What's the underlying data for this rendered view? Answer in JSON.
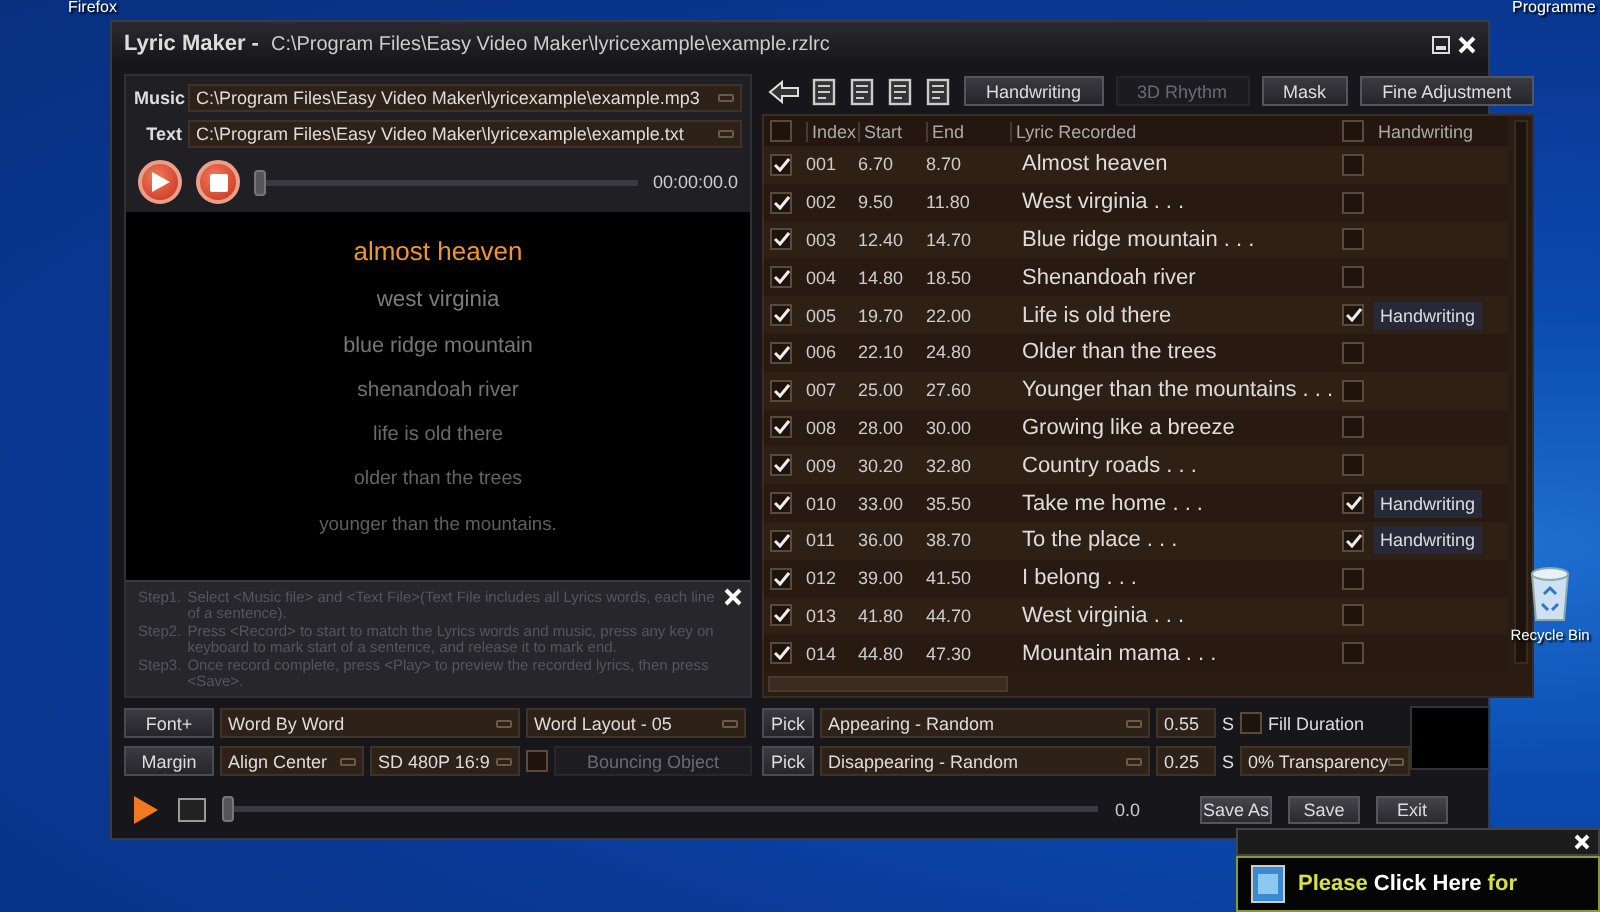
{
  "desktop": {
    "icons": [
      {
        "label": "Firefox",
        "kind": "top-left"
      },
      {
        "label": "Programme",
        "kind": "top-right"
      },
      {
        "label": "Recycle Bin",
        "kind": "bin"
      }
    ]
  },
  "window": {
    "title": "Lyric Maker -",
    "path": "C:\\Program Files\\Easy Video Maker\\lyricexample\\example.rzlrc"
  },
  "files": [
    {
      "label": "Music",
      "value": "C:\\Program Files\\Easy Video Maker\\lyricexample\\example.mp3"
    },
    {
      "label": "Text",
      "value": "C:\\Program Files\\Easy Video Maker\\lyricexample\\example.txt"
    }
  ],
  "player": {
    "time": "00:00:00.0",
    "level": 0
  },
  "preview": {
    "lines": [
      {
        "text": "almost heaven",
        "selected": true
      },
      {
        "text": "west virginia",
        "selected": false
      },
      {
        "text": "blue ridge mountain",
        "selected": false
      },
      {
        "text": "shenandoah river",
        "selected": false
      },
      {
        "text": "life is old there",
        "selected": false
      },
      {
        "text": "older than the trees",
        "selected": false
      },
      {
        "text": "younger than the mountains.",
        "selected": false
      }
    ]
  },
  "help": {
    "steps": [
      {
        "label": "Step1.",
        "text": "Select <Music file> and <Text File>(Text File includes all Lyrics words, each line of a sentence)."
      },
      {
        "label": "Step2.",
        "text": "Press <Record> to start to match the Lyrics words and music, press any key on keyboard to mark start of a sentence, and release it to mark end."
      },
      {
        "label": "Step3.",
        "text": "Once record complete, press <Play> to preview the recorded lyrics, then press <Save>."
      }
    ]
  },
  "toolbar": {
    "buttons": [
      {
        "label": "Handwriting",
        "disabled": false
      },
      {
        "label": "3D Rhythm",
        "disabled": true
      },
      {
        "label": "Mask",
        "disabled": false
      },
      {
        "label": "Fine Adjustment",
        "disabled": false
      }
    ]
  },
  "table": {
    "all_checked": false,
    "handwriting_all": false,
    "columns": [
      "Index",
      "Start",
      "End",
      "Lyric Recorded",
      "Handwriting"
    ],
    "rows": [
      {
        "checked": true,
        "index": "001",
        "start": "6.70",
        "end": "8.70",
        "lyric": "Almost heaven",
        "handwriting": false
      },
      {
        "checked": true,
        "index": "002",
        "start": "9.50",
        "end": "11.80",
        "lyric": "West virginia . . .",
        "handwriting": false
      },
      {
        "checked": true,
        "index": "003",
        "start": "12.40",
        "end": "14.70",
        "lyric": "Blue ridge mountain . . .",
        "handwriting": false
      },
      {
        "checked": true,
        "index": "004",
        "start": "14.80",
        "end": "18.50",
        "lyric": "Shenandoah river",
        "handwriting": false
      },
      {
        "checked": true,
        "index": "005",
        "start": "19.70",
        "end": "22.00",
        "lyric": "Life is old there",
        "handwriting": true,
        "handwriting_label": "Handwriting"
      },
      {
        "checked": true,
        "index": "006",
        "start": "22.10",
        "end": "24.80",
        "lyric": "Older than the trees",
        "handwriting": false
      },
      {
        "checked": true,
        "index": "007",
        "start": "25.00",
        "end": "27.60",
        "lyric": "Younger than the mountains . . .",
        "handwriting": false
      },
      {
        "checked": true,
        "index": "008",
        "start": "28.00",
        "end": "30.00",
        "lyric": "Growing like a breeze",
        "handwriting": false
      },
      {
        "checked": true,
        "index": "009",
        "start": "30.20",
        "end": "32.80",
        "lyric": "Country roads . . .",
        "handwriting": false
      },
      {
        "checked": true,
        "index": "010",
        "start": "33.00",
        "end": "35.50",
        "lyric": "Take me home . . .",
        "handwriting": true,
        "handwriting_label": "Handwriting"
      },
      {
        "checked": true,
        "index": "011",
        "start": "36.00",
        "end": "38.70",
        "lyric": "To the place . . .",
        "handwriting": true,
        "handwriting_label": "Handwriting"
      },
      {
        "checked": true,
        "index": "012",
        "start": "39.00",
        "end": "41.50",
        "lyric": "I belong . . .",
        "handwriting": false
      },
      {
        "checked": true,
        "index": "013",
        "start": "41.80",
        "end": "44.70",
        "lyric": "West virginia . . .",
        "handwriting": false
      },
      {
        "checked": true,
        "index": "014",
        "start": "44.80",
        "end": "47.30",
        "lyric": "Mountain mama . . .",
        "handwriting": false
      }
    ]
  },
  "controls": {
    "font_button": "Font+",
    "text_mode": "Word By Word",
    "word_layout": "Word Layout - 05",
    "margin_button": "Margin",
    "align": "Align Center",
    "resolution": "SD 480P 16:9",
    "bouncing": {
      "checked": false,
      "disabled": true,
      "label": "Bouncing Object"
    },
    "effects": [
      {
        "pick": "Pick",
        "value": "Appearing - Random",
        "duration": "0.55",
        "unit": "S"
      },
      {
        "pick": "Pick",
        "value": "Disappearing - Random",
        "duration": "0.25",
        "unit": "S"
      }
    ],
    "fill_duration": {
      "checked": false,
      "label": "Fill Duration"
    },
    "transparency": "0% Transparency"
  },
  "playback": {
    "time": "0.0",
    "level": 0
  },
  "actions": [
    "Save As",
    "Save",
    "Exit"
  ],
  "notification": {
    "parts": [
      {
        "text": "Please",
        "highlight": false
      },
      {
        "text": "Click Here",
        "highlight": true
      },
      {
        "text": "for",
        "highlight": false
      }
    ]
  }
}
